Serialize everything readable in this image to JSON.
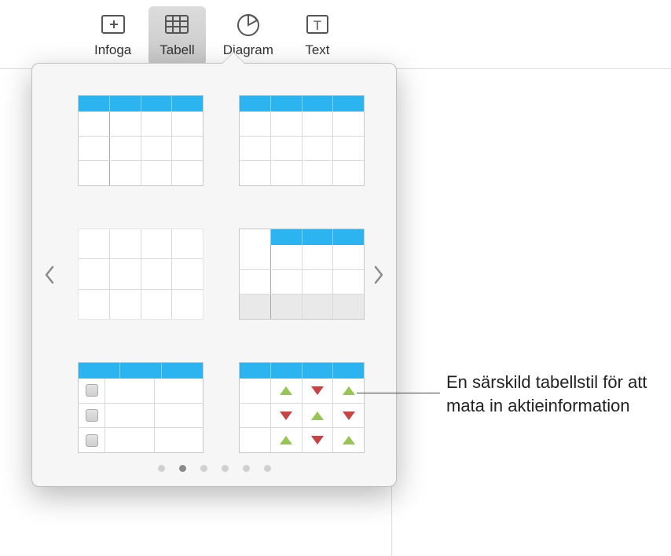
{
  "toolbar": {
    "items": [
      {
        "label": "Infoga",
        "icon": "insert-icon"
      },
      {
        "label": "Tabell",
        "icon": "table-icon",
        "selected": true
      },
      {
        "label": "Diagram",
        "icon": "chart-icon"
      },
      {
        "label": "Text",
        "icon": "text-icon"
      }
    ]
  },
  "popover": {
    "page_dots_total": 6,
    "page_dots_active_index": 1,
    "table_styles": [
      {
        "id": "style-header-firstcol",
        "header": true,
        "cols": 4,
        "rows": 3,
        "first_col_divider": true
      },
      {
        "id": "style-header-basic",
        "header": true,
        "cols": 4,
        "rows": 3
      },
      {
        "id": "style-plain",
        "header": false,
        "cols": 4,
        "rows": 3,
        "no_outer": true
      },
      {
        "id": "style-header-footer",
        "header": true,
        "cols": 4,
        "rows": 3,
        "first_col_divider": true,
        "footer": true,
        "blank_top_left": true
      },
      {
        "id": "style-checklist",
        "header": true,
        "cols": 3,
        "rows": 3,
        "first_col_checkbox": true
      },
      {
        "id": "style-stocks",
        "header": true,
        "cols": 4,
        "rows": 3,
        "stock_arrows": true
      }
    ]
  },
  "callout": {
    "text": "En särskild tabellstil för att mata in aktieinformation"
  },
  "colors": {
    "accent_header": "#2bb4f0"
  }
}
